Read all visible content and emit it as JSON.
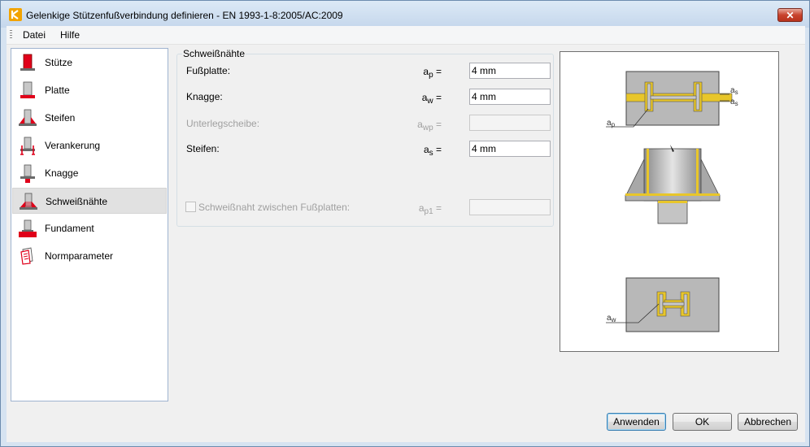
{
  "window": {
    "title": "Gelenkige Stützenfußverbindung definieren - EN 1993-1-8:2005/AC:2009",
    "close_symbol": "✕"
  },
  "menu": [
    {
      "label": "Datei"
    },
    {
      "label": "Hilfe"
    }
  ],
  "nav": {
    "items": [
      {
        "label": "Stütze",
        "icon": "column-icon"
      },
      {
        "label": "Platte",
        "icon": "base-plate-icon"
      },
      {
        "label": "Steifen",
        "icon": "stiffeners-icon"
      },
      {
        "label": "Verankerung",
        "icon": "anchorage-icon"
      },
      {
        "label": "Knagge",
        "icon": "shear-key-icon"
      },
      {
        "label": "Schweißnähte",
        "icon": "welds-icon",
        "selected": true
      },
      {
        "label": "Fundament",
        "icon": "foundation-icon"
      },
      {
        "label": "Normparameter",
        "icon": "code-parameters-icon"
      }
    ]
  },
  "welds": {
    "group_title": "Schweißnähte",
    "rows": [
      {
        "label": "Fußplatte:",
        "symbol": "a",
        "subscript": "p",
        "eq": "=",
        "value": "4 mm",
        "enabled": true
      },
      {
        "label": "Knagge:",
        "symbol": "a",
        "subscript": "w",
        "eq": "=",
        "value": "4 mm",
        "enabled": true
      },
      {
        "label": "Unterlegscheibe:",
        "symbol": "a",
        "subscript": "wp",
        "eq": "=",
        "value": "",
        "enabled": false
      },
      {
        "label": "Steifen:",
        "symbol": "a",
        "subscript": "s",
        "eq": "=",
        "value": "4 mm",
        "enabled": true
      }
    ],
    "checkbox": {
      "label": "Schweißnaht zwischen Fußplatten:",
      "checked": false,
      "enabled": false,
      "symbol": "a",
      "subscript": "p1",
      "eq": "=",
      "value": ""
    }
  },
  "preview": {
    "labels": {
      "ap": "a",
      "ap_sub": "p",
      "as": "a",
      "as_sub": "s",
      "aw": "a",
      "aw_sub": "w"
    }
  },
  "buttons": {
    "apply": "Anwenden",
    "ok": "OK",
    "cancel": "Abbrechen"
  },
  "colors": {
    "accent_red": "#e0001a",
    "weld_yellow": "#e8c62a",
    "steel_gray": "#b8b8b8"
  }
}
